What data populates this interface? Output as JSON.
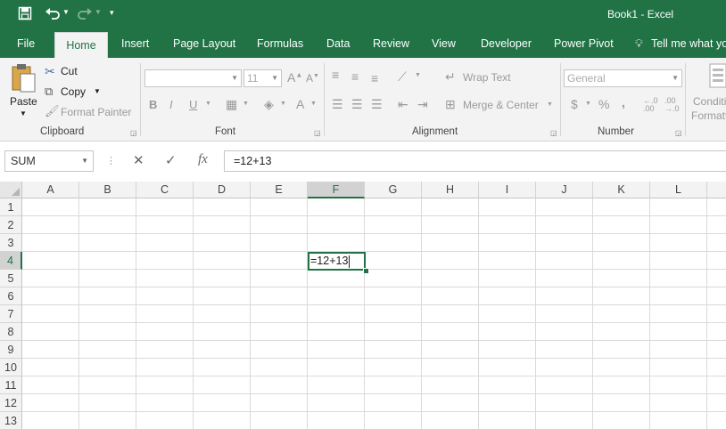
{
  "window": {
    "title": "Book1  -  Excel"
  },
  "qat": {
    "save_icon": "save-icon",
    "undo_icon": "undo-icon",
    "redo_icon": "redo-icon",
    "customize_icon": "customize-qat-icon"
  },
  "tabs": [
    {
      "label": "File"
    },
    {
      "label": "Home"
    },
    {
      "label": "Insert"
    },
    {
      "label": "Page Layout"
    },
    {
      "label": "Formulas"
    },
    {
      "label": "Data"
    },
    {
      "label": "Review"
    },
    {
      "label": "View"
    },
    {
      "label": "Developer"
    },
    {
      "label": "Power Pivot"
    }
  ],
  "tell_me": "Tell me what yo",
  "ribbon": {
    "clipboard": {
      "label": "Clipboard",
      "paste": "Paste",
      "cut": "Cut",
      "copy": "Copy",
      "format_painter": "Format Painter"
    },
    "font": {
      "label": "Font",
      "font_name": "",
      "font_size": "11",
      "bold": "B",
      "italic": "I",
      "underline": "U"
    },
    "alignment": {
      "label": "Alignment",
      "wrap_text": "Wrap Text",
      "merge_center": "Merge & Center"
    },
    "number": {
      "label": "Number",
      "format": "General",
      "currency": "$",
      "percent": "%",
      "comma": ","
    },
    "styles": {
      "cond_format_1": "Conditi",
      "cond_format_2": "Formatti"
    }
  },
  "formula_bar": {
    "name_box": "SUM",
    "cancel": "✕",
    "enter": "✓",
    "fx": "fx",
    "formula": "=12+13"
  },
  "sheet": {
    "columns": [
      "A",
      "B",
      "C",
      "D",
      "E",
      "F",
      "G",
      "H",
      "I",
      "J",
      "K",
      "L"
    ],
    "rows": [
      "1",
      "2",
      "3",
      "4",
      "5",
      "6",
      "7",
      "8",
      "9",
      "10",
      "11",
      "12",
      "13"
    ],
    "selected_column": "F",
    "selected_row": "4",
    "active_cell_text": "=12+13"
  },
  "colors": {
    "accent": "#217346",
    "ribbon_bg": "#f3f3f3"
  }
}
